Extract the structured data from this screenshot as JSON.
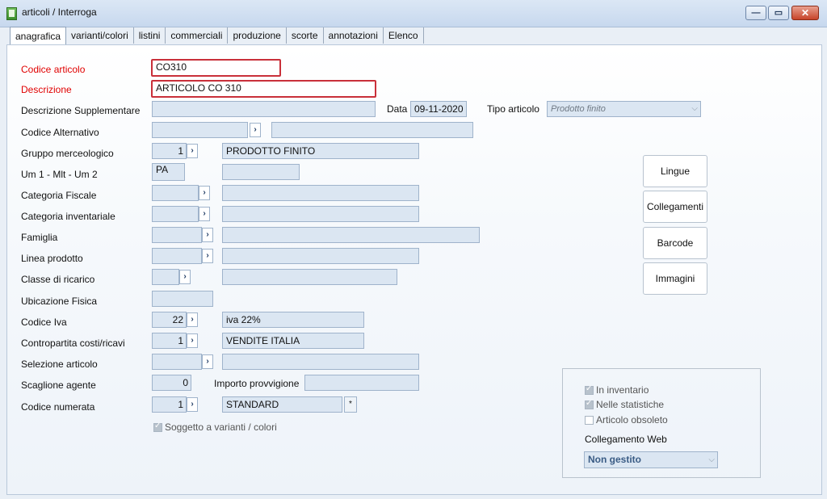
{
  "window": {
    "title": "articoli / Interroga"
  },
  "tabs": [
    "anagrafica",
    "varianti/colori",
    "listini",
    "commerciali",
    "produzione",
    "scorte",
    "annotazioni",
    "Elenco"
  ],
  "labels": {
    "codice_articolo": "Codice articolo",
    "descrizione": "Descrizione",
    "descr_supp": "Descrizione Supplementare",
    "data": "Data",
    "tipo_articolo": "Tipo articolo",
    "codice_alternativo": "Codice Alternativo",
    "gruppo_merceologico": "Gruppo merceologico",
    "um": "Um 1 - Mlt - Um 2",
    "categoria_fiscale": "Categoria Fiscale",
    "categoria_inventariale": "Categoria inventariale",
    "famiglia": "Famiglia",
    "linea_prodotto": "Linea prodotto",
    "classe_ricarico": "Classe di ricarico",
    "ubicazione_fisica": "Ubicazione Fisica",
    "codice_iva": "Codice Iva",
    "contropartita": "Contropartita costi/ricavi",
    "selezione_articolo": "Selezione articolo",
    "scaglione_agente": "Scaglione agente",
    "importo_provvigione": "Importo provvigione",
    "codice_numerata": "Codice numerata",
    "soggetto_varianti": "Soggetto a varianti / colori"
  },
  "values": {
    "codice_articolo": "CO310",
    "descrizione": "ARTICOLO CO 310",
    "data": "09-11-2020",
    "tipo_articolo": "Prodotto finito",
    "gruppo_code": "1",
    "gruppo_desc": "PRODOTTO FINITO",
    "um1": "PA",
    "iva_code": "22",
    "iva_desc": "iva 22%",
    "contropartita_code": "1",
    "contropartita_desc": "VENDITE ITALIA",
    "scaglione": "0",
    "numerata_code": "1",
    "numerata_desc": "STANDARD",
    "numerata_mark": "*"
  },
  "side_buttons": [
    "Lingue",
    "Collegamenti",
    "Barcode",
    "Immagini"
  ],
  "group": {
    "in_inventario": "In inventario",
    "nelle_statistiche": "Nelle statistiche",
    "articolo_obsoleto": "Articolo obsoleto",
    "collegamento_web": "Collegamento Web",
    "collegamento_value": "Non gestito"
  },
  "icons": {
    "arrow": "›",
    "dropdown": "⌵",
    "minimize": "—",
    "maximize": "▭",
    "close": "✕"
  }
}
